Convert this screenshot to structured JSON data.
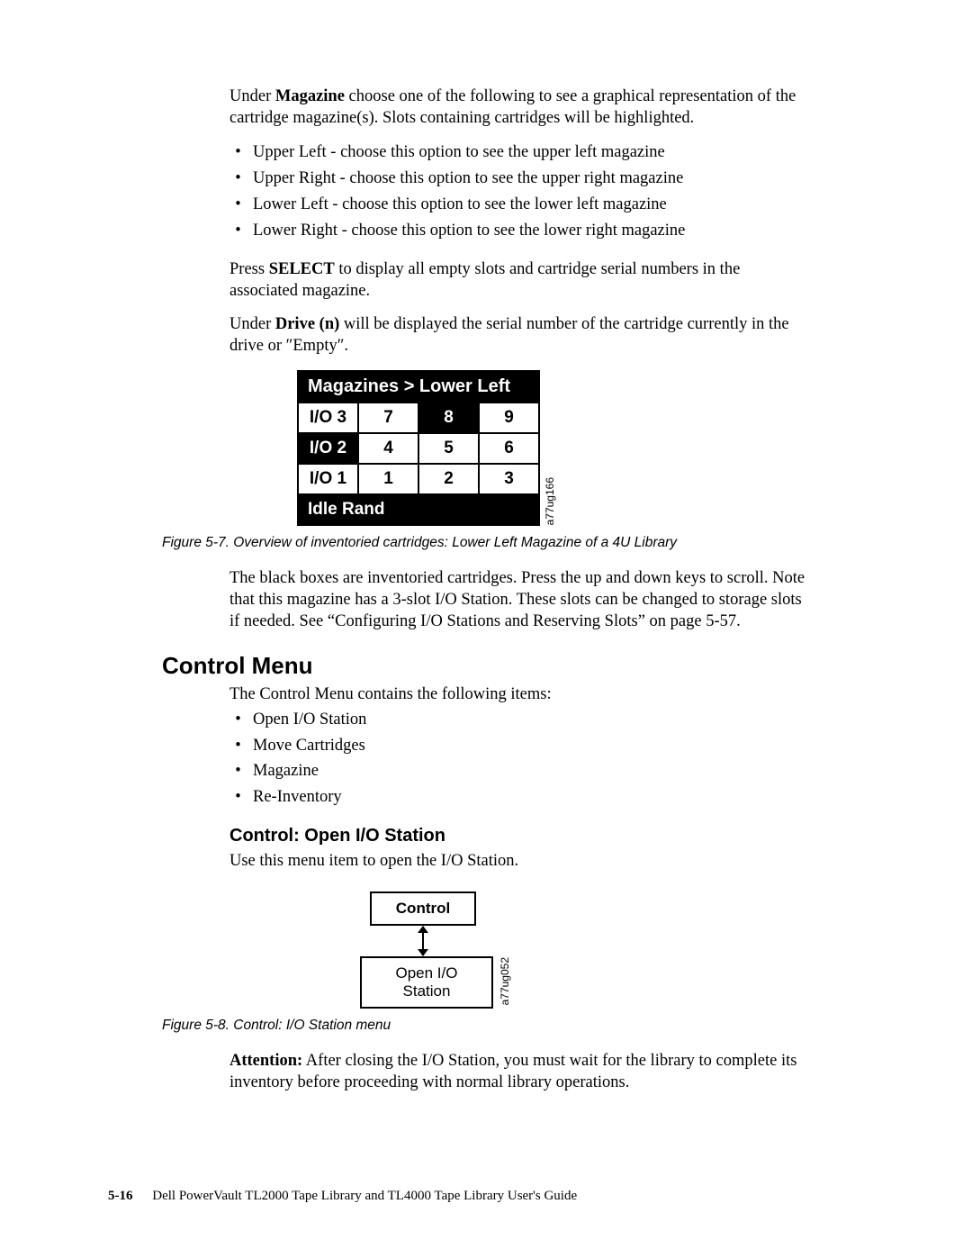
{
  "para1_a": "Under ",
  "para1_bold": "Magazine",
  "para1_b": " choose one of the following to see a graphical representation of the cartridge magazine(s). Slots containing cartridges will be highlighted.",
  "mag_options": [
    "Upper Left - choose this option to see the upper left magazine",
    "Upper Right - choose this option to see the upper right magazine",
    "Lower Left - choose this option to see the lower left magazine",
    "Lower Right - choose this option to see the lower right magazine"
  ],
  "para2_a": "Press ",
  "para2_bold": "SELECT",
  "para2_b": " to display all empty slots and cartridge serial numbers in the associated magazine.",
  "para3_a": "Under ",
  "para3_bold": "Drive (n)",
  "para3_b": " will be displayed the serial number of the cartridge currently in the drive or ″Empty″.",
  "fig7": {
    "header": "Magazines > Lower Left",
    "rows": [
      [
        "I/O 3",
        "7",
        "8",
        "9"
      ],
      [
        "I/O 2",
        "4",
        "5",
        "6"
      ],
      [
        "I/O 1",
        "1",
        "2",
        "3"
      ]
    ],
    "footer": "Idle Rand",
    "sidelabel": "a77ug166",
    "caption": "Figure 5-7. Overview of inventoried cartridges: Lower Left Magazine of a 4U Library"
  },
  "para4": "The black boxes are inventoried cartridges. Press the up and down keys to scroll. Note that this magazine has a 3-slot I/O Station. These slots can be changed to storage slots if needed. See “Configuring I/O Stations and Reserving Slots” on page 5-57.",
  "control": {
    "heading": "Control Menu",
    "intro": "The Control Menu contains the following items:",
    "items": [
      "Open I/O Station",
      "Move Cartridges",
      "Magazine",
      "Re-Inventory"
    ],
    "sub_heading": "Control: Open I/O Station",
    "sub_text": "Use this menu item to open the I/O Station."
  },
  "fig8": {
    "top": "Control",
    "bottom": "Open I/O Station",
    "sidelabel": "a77ug052",
    "caption": "Figure 5-8. Control: I/O Station menu"
  },
  "attention_a": "Attention:",
  "attention_b": " After closing the I/O Station, you must wait for the library to complete its inventory before proceeding with normal library operations.",
  "footer": {
    "page": "5-16",
    "title": "Dell PowerVault TL2000 Tape Library and TL4000 Tape Library User's Guide"
  }
}
